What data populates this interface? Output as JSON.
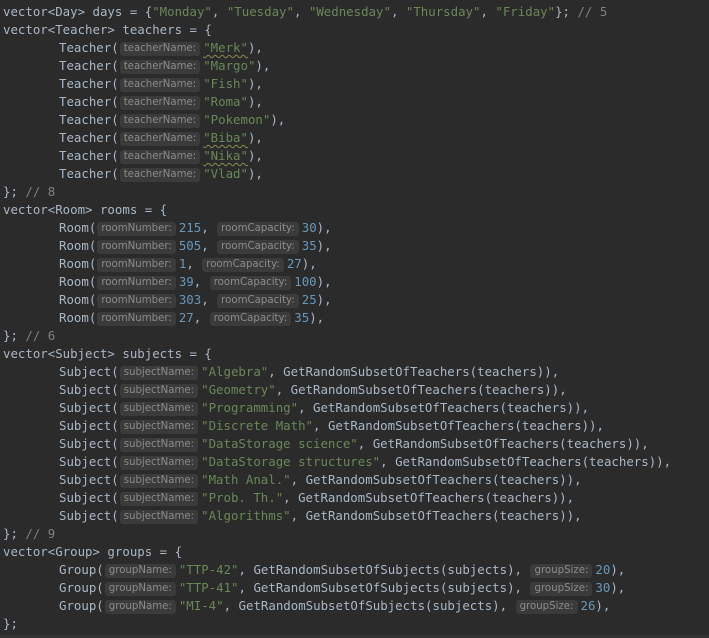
{
  "code": {
    "days_line": {
      "decl": "vector<Day> days = {",
      "items": [
        "\"Monday\"",
        "\"Tuesday\"",
        "\"Wednesday\"",
        "\"Thursday\"",
        "\"Friday\""
      ],
      "close": "};",
      "comment": "// 5"
    },
    "teachers": {
      "decl": "vector<Teacher> teachers = {",
      "ctor": "Teacher(",
      "hint": "teacherName:",
      "names": [
        "\"Merk\"",
        "\"Margo\"",
        "\"Fish\"",
        "\"Roma\"",
        "\"Pokemon\"",
        "\"Biba\"",
        "\"Nika\"",
        "\"Vlad\""
      ],
      "close": "};",
      "comment": "// 8"
    },
    "rooms": {
      "decl": "vector<Room> rooms = {",
      "ctor": "Room(",
      "hint_number": "roomNumber:",
      "hint_capacity": "roomCapacity:",
      "items": [
        {
          "number": "215",
          "capacity": "30"
        },
        {
          "number": "505",
          "capacity": "35"
        },
        {
          "number": "1",
          "capacity": "27"
        },
        {
          "number": "39",
          "capacity": "100"
        },
        {
          "number": "303",
          "capacity": "25"
        },
        {
          "number": "27",
          "capacity": "35"
        }
      ],
      "close": "};",
      "comment": "// 6"
    },
    "subjects": {
      "decl": "vector<Subject> subjects = {",
      "ctor": "Subject(",
      "hint": "subjectName:",
      "call": "GetRandomSubsetOfTeachers(teachers)),",
      "names": [
        "\"Algebra\"",
        "\"Geometry\"",
        "\"Programming\"",
        "\"Discrete Math\"",
        "\"DataStorage science\"",
        "\"DataStorage structures\"",
        "\"Math Anal.\"",
        "\"Prob. Th.\"",
        "\"Algorithms\""
      ],
      "close": "};",
      "comment": "// 9"
    },
    "groups": {
      "decl": "vector<Group> groups = {",
      "ctor": "Group(",
      "hint_name": "groupName:",
      "hint_size": "groupSize:",
      "call": "GetRandomSubsetOfSubjects(subjects),",
      "items": [
        {
          "name": "\"TTP-42\"",
          "size": "20"
        },
        {
          "name": "\"TTP-41\"",
          "size": "30"
        },
        {
          "name": "\"MI-4\"",
          "size": "26"
        }
      ],
      "close": "};"
    }
  },
  "colors": {
    "background": "#2b2b2b",
    "text": "#a9b7c6",
    "string": "#6a8759",
    "number": "#6897bb",
    "comment": "#808080",
    "hint_bg": "#3b3b3b",
    "hint_text": "#8b8b8b"
  }
}
